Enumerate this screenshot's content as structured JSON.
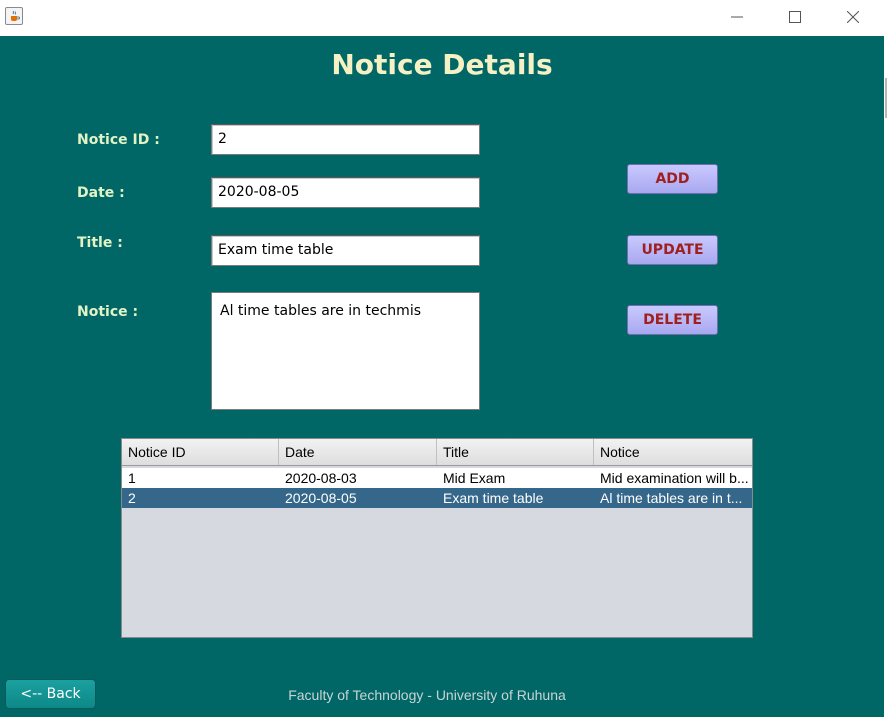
{
  "window": {
    "minimize_glyph": "minimize-icon",
    "maximize_glyph": "maximize-icon",
    "close_glyph": "close-icon",
    "app_icon": "java-cup-icon"
  },
  "form": {
    "heading": "Notice Details",
    "notice_id_label": "Notice ID :",
    "notice_id_value": "2",
    "date_label": "Date :",
    "date_value": "2020-08-05",
    "title_label": "Title :",
    "title_value": "Exam time table",
    "notice_label": "Notice :",
    "notice_value": "Al time tables are in techmis"
  },
  "actions": {
    "add_label": "ADD",
    "update_label": "UPDATE",
    "delete_label": "DELETE"
  },
  "table": {
    "columns": [
      "Notice ID",
      "Date",
      "Title",
      "Notice"
    ],
    "rows": [
      {
        "id": "1",
        "date": "2020-08-03",
        "title": "Mid Exam",
        "notice": "Mid examination will b...",
        "selected": false
      },
      {
        "id": "2",
        "date": "2020-08-05",
        "title": "Exam time table",
        "notice": "Al time tables are in t...",
        "selected": true
      }
    ]
  },
  "footer": {
    "back_label": "<-- Back",
    "credit": "Faculty of Technology - University of Ruhuna"
  },
  "colors": {
    "background": "#006666",
    "heading": "#f5f1c4",
    "label": "#e2f3c6",
    "button_text": "#a02020",
    "button_bg": "#b8b8f8",
    "selected_row": "#35678a"
  }
}
